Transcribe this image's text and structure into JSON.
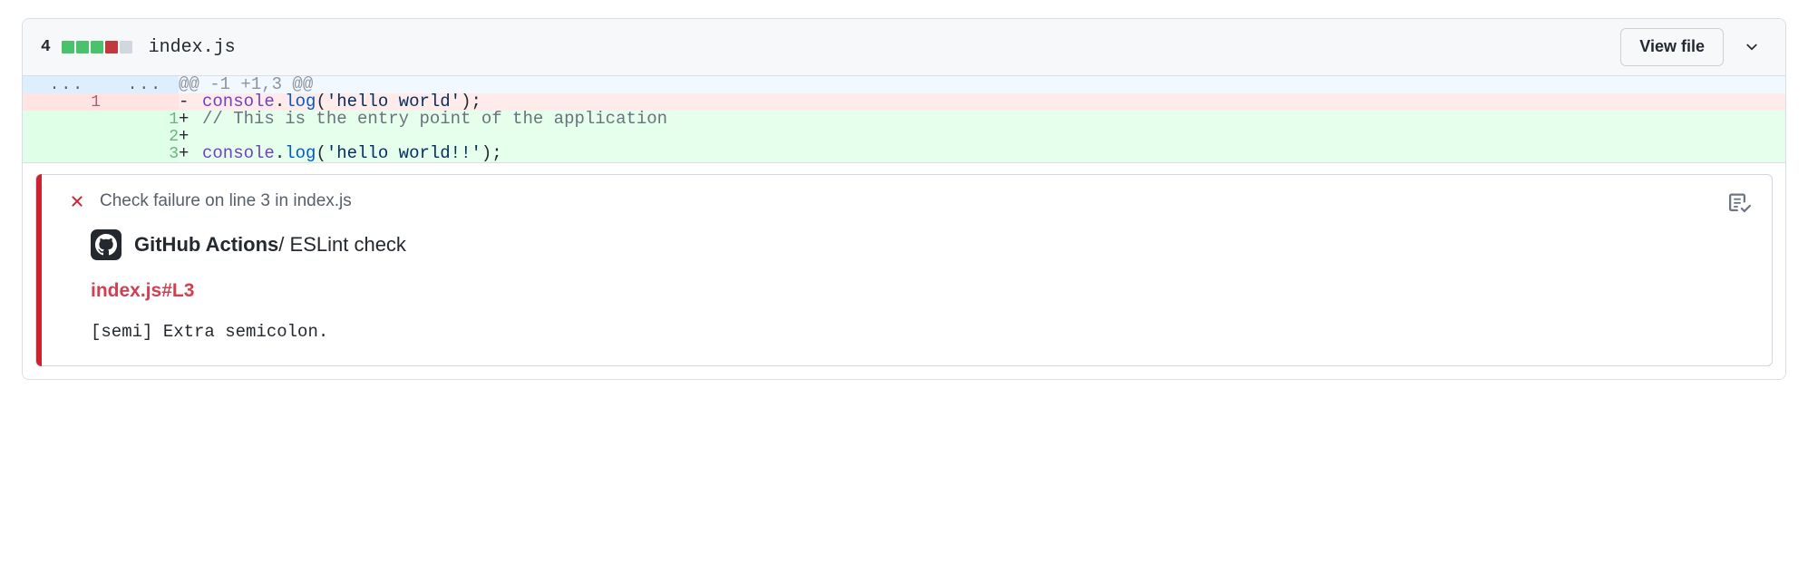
{
  "file_header": {
    "change_count": "4",
    "file_name": "index.js",
    "diffstat_blocks": [
      "#4ac26b",
      "#4ac26b",
      "#4ac26b",
      "#c2393d",
      "#d0d7de"
    ],
    "view_file_label": "View file",
    "chevron_icon": "chevron-down-icon"
  },
  "diff": {
    "hunk": {
      "old_ln": "...",
      "new_ln": "...",
      "header": "@@ -1 +1,3 @@"
    },
    "rows": [
      {
        "type": "del",
        "old_ln": "1",
        "new_ln": "",
        "marker": "-",
        "tokens": [
          {
            "t": "console",
            "c": "tok-obj"
          },
          {
            "t": ".",
            "c": "tok-pun"
          },
          {
            "t": "log",
            "c": "tok-prop"
          },
          {
            "t": "(",
            "c": "tok-pun"
          },
          {
            "t": "'hello world'",
            "c": "tok-str"
          },
          {
            "t": ");",
            "c": "tok-pun"
          }
        ]
      },
      {
        "type": "add",
        "old_ln": "",
        "new_ln": "1",
        "marker": "+",
        "tokens": [
          {
            "t": "// This is the entry point of the application",
            "c": "tok-cmt"
          }
        ]
      },
      {
        "type": "add",
        "old_ln": "",
        "new_ln": "2",
        "marker": "+",
        "tokens": []
      },
      {
        "type": "add",
        "old_ln": "",
        "new_ln": "3",
        "marker": "+",
        "tokens": [
          {
            "t": "console",
            "c": "tok-obj"
          },
          {
            "t": ".",
            "c": "tok-pun"
          },
          {
            "t": "log",
            "c": "tok-prop"
          },
          {
            "t": "(",
            "c": "tok-pun"
          },
          {
            "t": "'hello world!!'",
            "c": "tok-str"
          },
          {
            "t": ");",
            "c": "tok-pun"
          }
        ]
      }
    ]
  },
  "annotation": {
    "status_icon": "x-failure-icon",
    "title": "Check failure on line 3 in index.js",
    "report_icon": "checklist-report-icon",
    "app_logo_icon": "github-mark-icon",
    "app_name": "GitHub Actions",
    "check_name": "/ ESLint check",
    "link_text": "index.js#L3",
    "message": "[semi] Extra semicolon.",
    "accent_color": "#cf222e",
    "link_color": "#cf4152"
  }
}
